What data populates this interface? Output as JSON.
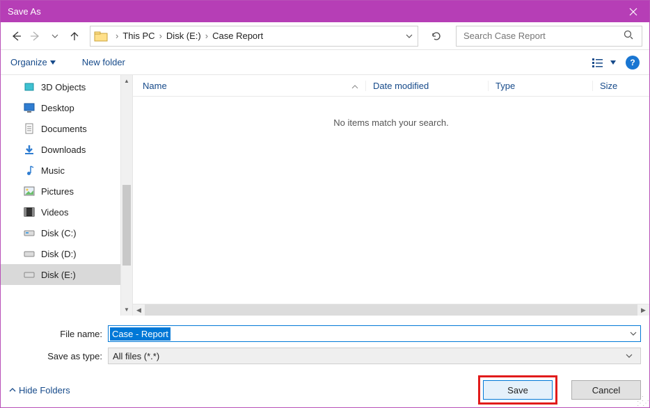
{
  "window": {
    "title": "Save As"
  },
  "breadcrumbs": {
    "b1": "This PC",
    "b2": "Disk (E:)",
    "b3": "Case Report"
  },
  "search": {
    "placeholder": "Search Case Report"
  },
  "toolbar": {
    "organize": "Organize",
    "newfolder": "New folder"
  },
  "tree": {
    "i0": "3D Objects",
    "i1": "Desktop",
    "i2": "Documents",
    "i3": "Downloads",
    "i4": "Music",
    "i5": "Pictures",
    "i6": "Videos",
    "i7": "Disk (C:)",
    "i8": "Disk (D:)",
    "i9": "Disk (E:)"
  },
  "columns": {
    "name": "Name",
    "date": "Date modified",
    "type": "Type",
    "size": "Size"
  },
  "empty_msg": "No items match your search.",
  "form": {
    "fname_label": "File name:",
    "fname_value": "Case - Report",
    "ftype_label": "Save as type:",
    "ftype_value": "All files (*.*)"
  },
  "footer": {
    "hide": "Hide Folders",
    "save": "Save",
    "cancel": "Cancel"
  }
}
